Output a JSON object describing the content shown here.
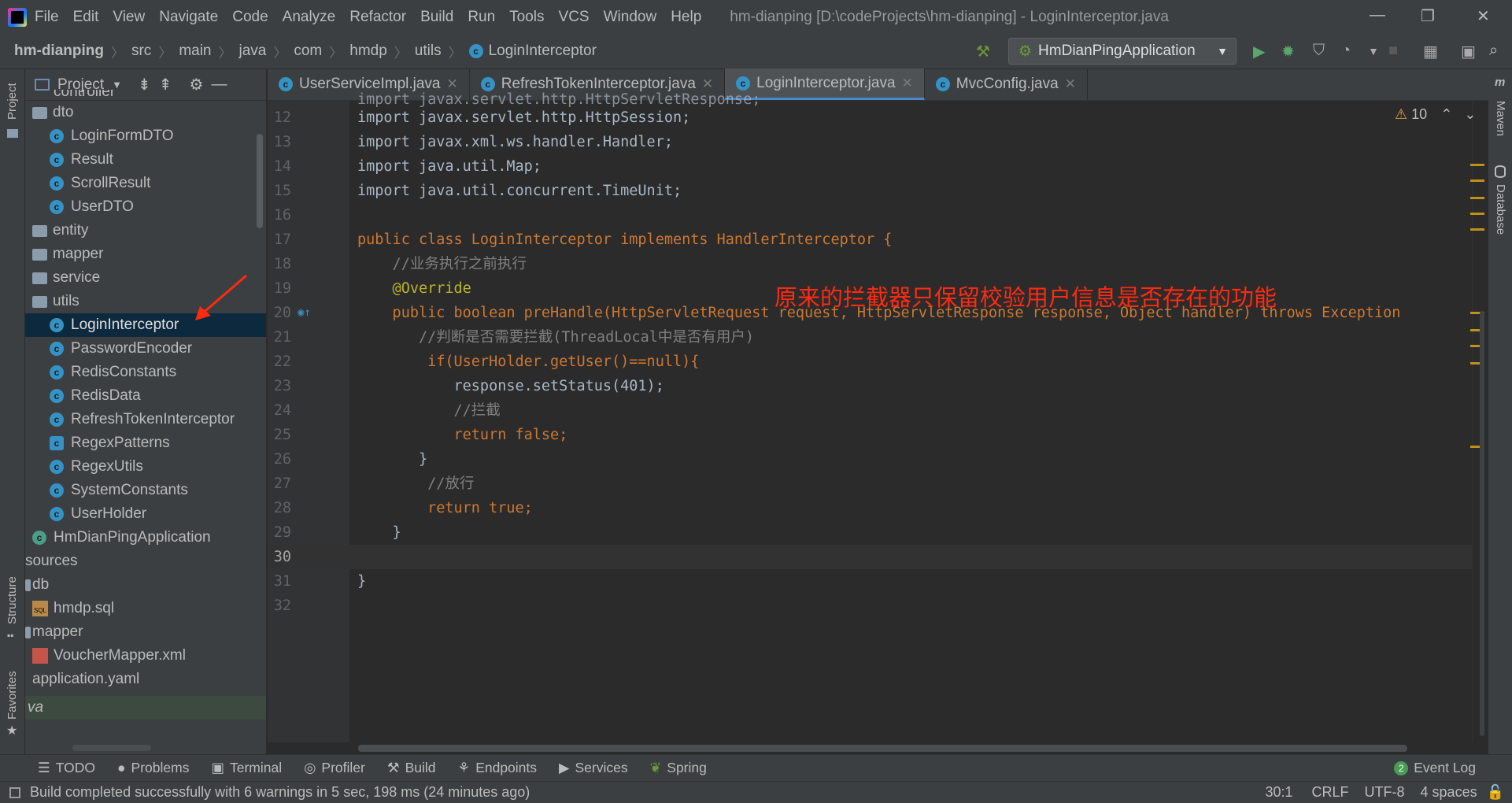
{
  "menubar": {
    "items": [
      "File",
      "Edit",
      "View",
      "Navigate",
      "Code",
      "Analyze",
      "Refactor",
      "Build",
      "Run",
      "Tools",
      "VCS",
      "Window",
      "Help"
    ],
    "title": "hm-dianping [D:\\codeProjects\\hm-dianping] - LoginInterceptor.java"
  },
  "breadcrumb": [
    "hm-dianping",
    "src",
    "main",
    "java",
    "com",
    "hmdp",
    "utils",
    "LoginInterceptor"
  ],
  "run_config": "HmDianPingApplication",
  "left_strip": {
    "project": "Project",
    "structure": "Structure",
    "favorites": "Favorites"
  },
  "project_panel": {
    "title": "Project",
    "items": [
      {
        "label": "controller",
        "kind": "folder"
      },
      {
        "label": "dto",
        "kind": "folder"
      },
      {
        "label": "LoginFormDTO",
        "kind": "class"
      },
      {
        "label": "Result",
        "kind": "class"
      },
      {
        "label": "ScrollResult",
        "kind": "class"
      },
      {
        "label": "UserDTO",
        "kind": "class"
      },
      {
        "label": "entity",
        "kind": "folder"
      },
      {
        "label": "mapper",
        "kind": "folder"
      },
      {
        "label": "service",
        "kind": "folder"
      },
      {
        "label": "utils",
        "kind": "folder"
      },
      {
        "label": "LoginInterceptor",
        "kind": "class",
        "selected": true
      },
      {
        "label": "PasswordEncoder",
        "kind": "class"
      },
      {
        "label": "RedisConstants",
        "kind": "class"
      },
      {
        "label": "RedisData",
        "kind": "class"
      },
      {
        "label": "RefreshTokenInterceptor",
        "kind": "class"
      },
      {
        "label": "RegexPatterns",
        "kind": "class"
      },
      {
        "label": "RegexUtils",
        "kind": "class"
      },
      {
        "label": "SystemConstants",
        "kind": "class"
      },
      {
        "label": "UserHolder",
        "kind": "class"
      },
      {
        "label": "HmDianPingApplication",
        "kind": "app"
      },
      {
        "label": "sources",
        "kind": "plain"
      },
      {
        "label": "db",
        "kind": "folder"
      },
      {
        "label": "hmdp.sql",
        "kind": "sql"
      },
      {
        "label": "mapper",
        "kind": "folder"
      },
      {
        "label": "VoucherMapper.xml",
        "kind": "xml"
      },
      {
        "label": "application.yaml",
        "kind": "plain"
      },
      {
        "label": "va",
        "kind": "plain"
      }
    ]
  },
  "tabs": [
    {
      "label": "UserServiceImpl.java",
      "active": false
    },
    {
      "label": "RefreshTokenInterceptor.java",
      "active": false
    },
    {
      "label": "LoginInterceptor.java",
      "active": true
    },
    {
      "label": "MvcConfig.java",
      "active": false
    }
  ],
  "code": {
    "lines": [
      {
        "n": "",
        "t": "import javax.servlet.http.HttpServletResponse;"
      },
      {
        "n": "12",
        "t": "import javax.servlet.http.HttpSession;"
      },
      {
        "n": "13",
        "t": "import javax.xml.ws.handler.Handler;"
      },
      {
        "n": "14",
        "t": "import java.util.Map;"
      },
      {
        "n": "15",
        "t": "import java.util.concurrent.TimeUnit;"
      },
      {
        "n": "16",
        "t": ""
      },
      {
        "n": "17",
        "t": "public class LoginInterceptor implements HandlerInterceptor {"
      },
      {
        "n": "18",
        "t": "    //业务执行之前执行"
      },
      {
        "n": "19",
        "t": "    @Override"
      },
      {
        "n": "20",
        "t": "    public boolean preHandle(HttpServletRequest request, HttpServletResponse response, Object handler) throws Exception"
      },
      {
        "n": "21",
        "t": "       //判断是否需要拦截(ThreadLocal中是否有用户)"
      },
      {
        "n": "22",
        "t": "        if(UserHolder.getUser()==null){"
      },
      {
        "n": "23",
        "t": "           response.setStatus(401);"
      },
      {
        "n": "24",
        "t": "           //拦截"
      },
      {
        "n": "25",
        "t": "           return false;"
      },
      {
        "n": "26",
        "t": "       }"
      },
      {
        "n": "27",
        "t": "        //放行"
      },
      {
        "n": "28",
        "t": "        return true;"
      },
      {
        "n": "29",
        "t": "    }"
      },
      {
        "n": "30",
        "t": ""
      },
      {
        "n": "31",
        "t": "}"
      },
      {
        "n": "32",
        "t": ""
      }
    ],
    "annotation": "原来的拦截器只保留校验用户信息是否存在的功能",
    "warnings_count": "10"
  },
  "right_strip": {
    "maven": "Maven",
    "database": "Database"
  },
  "toolwindows": [
    "TODO",
    "Problems",
    "Terminal",
    "Profiler",
    "Build",
    "Endpoints",
    "Services",
    "Spring"
  ],
  "event_log": {
    "count": "2",
    "label": "Event Log"
  },
  "status": {
    "message": "Build completed successfully with 6 warnings in 5 sec, 198 ms (24 minutes ago)",
    "position": "30:1",
    "line_sep": "CRLF",
    "encoding": "UTF-8",
    "indent": "4 spaces"
  },
  "colors": {
    "keyword": "#cc7832",
    "method": "#ffc66d",
    "annotation_text": "#ff2a10",
    "selection": "#0d293e"
  }
}
